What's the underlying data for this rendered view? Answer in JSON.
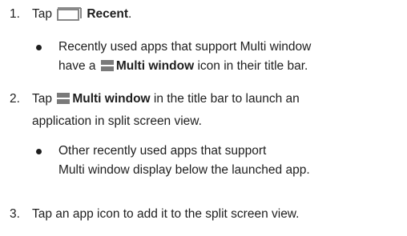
{
  "steps": [
    {
      "number": "1.",
      "prefix": "Tap",
      "icon": "recent-apps-icon",
      "bold": "Recent",
      "suffix": ".",
      "bullet": {
        "line1": "Recently used apps that support Multi window",
        "line2_prefix": "have a",
        "icon": "multi-window-icon",
        "line2_bold": "Multi window",
        "line2_suffix": "icon in their title bar."
      }
    },
    {
      "number": "2.",
      "prefix": "Tap",
      "icon": "multi-window-icon",
      "bold": "Multi window",
      "line1_suffix": "in the title bar to launch an",
      "line2": "application in split screen view.",
      "bullet": {
        "line1": "Other recently used apps that support",
        "line2": "Multi window display below the launched app."
      }
    },
    {
      "number": "3.",
      "text": "Tap an app icon to add it to the split screen view."
    }
  ],
  "colors": {
    "text": "#1e1e1e",
    "icon": "#7a7a7a"
  }
}
